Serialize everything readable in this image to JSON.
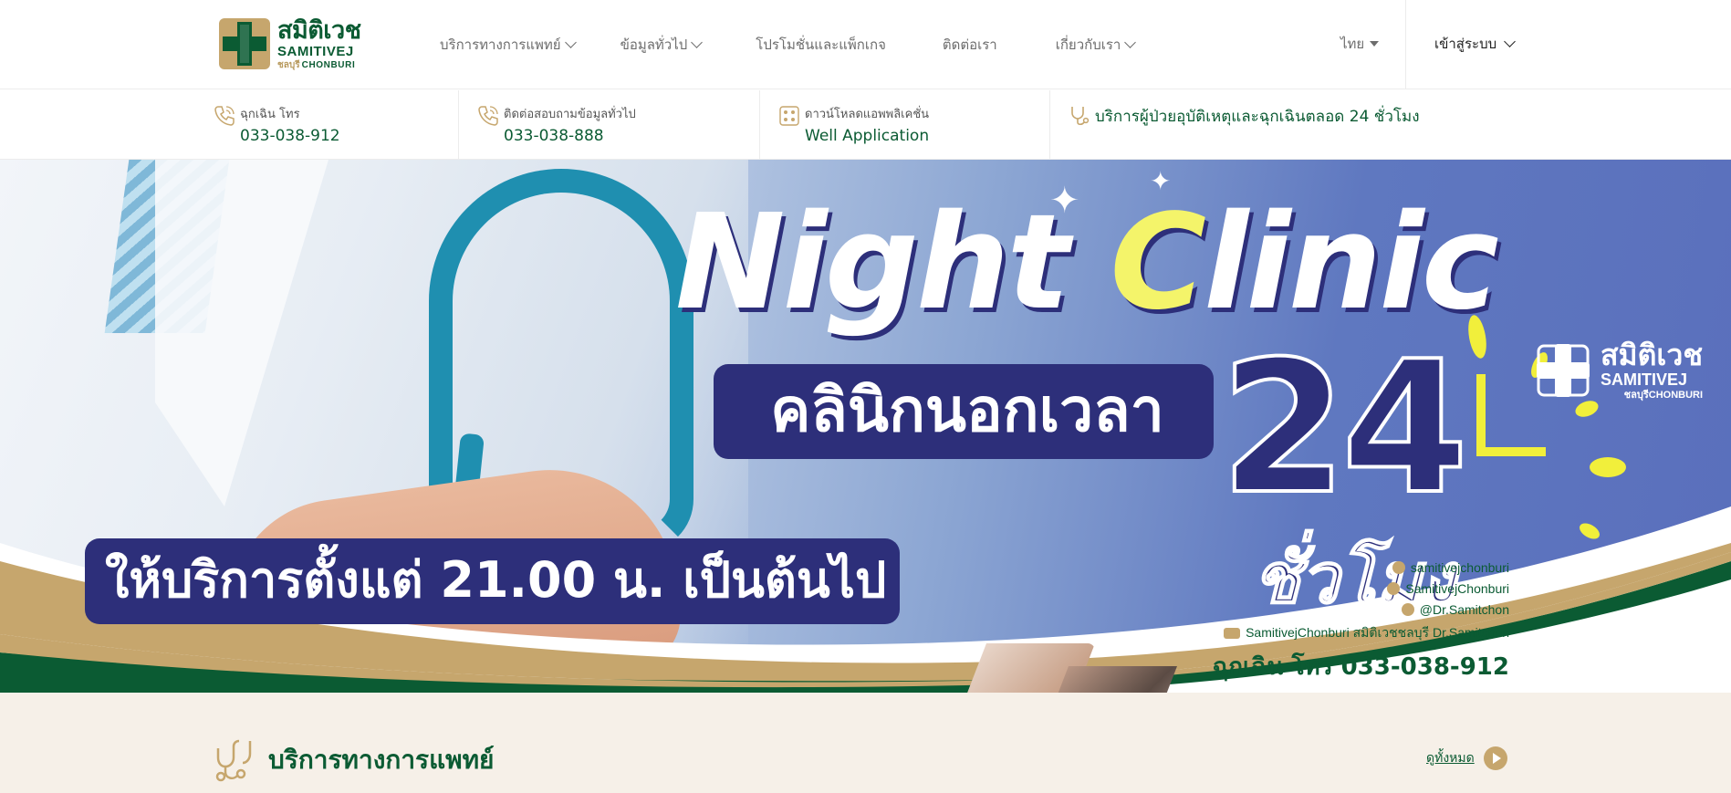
{
  "logo": {
    "thai": "สมิติเวช",
    "english": "SAMITIVEJ",
    "sub_thai": "ชลบุรี",
    "sub_english": "CHONBURI"
  },
  "nav": {
    "items": [
      {
        "label": "บริการทางการแพทย์",
        "has_dropdown": true
      },
      {
        "label": "ข้อมูลทั่วไป",
        "has_dropdown": true
      },
      {
        "label": "โปรโมชั่นและแพ็กเกจ",
        "has_dropdown": false
      },
      {
        "label": "ติดต่อเรา",
        "has_dropdown": false
      },
      {
        "label": "เกี่ยวกับเรา",
        "has_dropdown": true
      }
    ],
    "language": "ไทย",
    "login": "เข้าสู่ระบบ"
  },
  "info_bar": {
    "emergency_label": "ฉุกเฉิน โทร",
    "emergency_value": "033-038-912",
    "contact_label": "ติดต่อสอบถามข้อมูลทั่วไป",
    "contact_value": "033-038-888",
    "app_label": "ดาวน์โหลดแอพพลิเคชั่น",
    "app_value": "Well Application",
    "service_24h": "บริการผู้ป่วยอุบัติเหตุและฉุกเฉินตลอด 24 ชั่วโมง"
  },
  "hero": {
    "title_part1": "Night ",
    "title_highlight": "C",
    "title_part2": "linic",
    "thai_title": "คลินิกนอกเวลา",
    "hours_number": "24",
    "hours_thai": "ชั่วโมง",
    "service_time": "ให้บริการตั้งแต่ 21.00 น. เป็นต้นไป",
    "logo_thai": "สมิติเวช",
    "logo_english": "SAMITIVEJ",
    "logo_sub": "ชลบุรีCHONBURI",
    "socials": [
      {
        "icon": "instagram-icon",
        "text": "samitivejchonburi"
      },
      {
        "icon": "facebook-icon",
        "text": "SamitivejChonburi"
      },
      {
        "icon": "line-icon",
        "text": "@Dr.Samitchon"
      },
      {
        "icon": "youtube-icon",
        "text": "SamitivejChonburi สมิติเวชชลบุรี Dr.Samitchon"
      }
    ],
    "emergency": "ฉุกเฉิน โทร 033-038-912"
  },
  "section": {
    "title": "บริการทางการแพทย์",
    "see_all": "ดูทั้งหมด"
  },
  "colors": {
    "brand_green": "#0b5b33",
    "brand_gold": "#c6a66d",
    "hero_navy": "#2d2f7a",
    "hero_yellow": "#f4f46a",
    "section_bg": "#f6f0e8"
  }
}
